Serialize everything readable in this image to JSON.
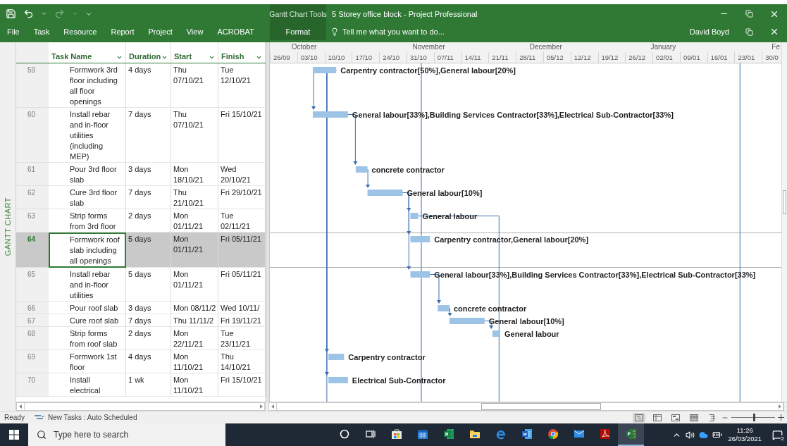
{
  "title_bar": {
    "contextual_group": "Gantt Chart Tools",
    "title": "5 Storey office block - Project Professional"
  },
  "ribbon": {
    "tabs": [
      {
        "label": "File",
        "contextual": false
      },
      {
        "label": "Task",
        "contextual": false
      },
      {
        "label": "Resource",
        "contextual": false
      },
      {
        "label": "Report",
        "contextual": false
      },
      {
        "label": "Project",
        "contextual": false
      },
      {
        "label": "View",
        "contextual": false
      },
      {
        "label": "ACROBAT",
        "contextual": false
      },
      {
        "label": "Format",
        "contextual": true
      }
    ],
    "tell_me": "Tell me what you want to do...",
    "user": "David Boyd"
  },
  "view_bar": {
    "label": "GANTT CHART"
  },
  "table": {
    "columns": [
      {
        "label": "Task Name"
      },
      {
        "label": "Duration"
      },
      {
        "label": "Start"
      },
      {
        "label": "Finish"
      }
    ],
    "rows": [
      {
        "id": "59",
        "name": "Formwork 3rd floor including all floor openings",
        "duration": "4 days",
        "start": "Thu 07/10/21",
        "finish": "Tue 12/10/21",
        "selected": false
      },
      {
        "id": "60",
        "name": "Install rebar and in-floor utilities (including MEP)",
        "duration": "7 days",
        "start": "Thu 07/10/21",
        "finish": "Fri 15/10/21",
        "selected": false
      },
      {
        "id": "61",
        "name": "Pour 3rd floor slab",
        "duration": "3 days",
        "start": "Mon 18/10/21",
        "finish": "Wed 20/10/21",
        "selected": false
      },
      {
        "id": "62",
        "name": "Cure 3rd floor slab",
        "duration": "7 days",
        "start": "Thu 21/10/21",
        "finish": "Fri 29/10/21",
        "selected": false
      },
      {
        "id": "63",
        "name": "Strip forms from 3rd floor",
        "duration": "2 days",
        "start": "Mon 01/11/21",
        "finish": "Tue 02/11/21",
        "selected": false
      },
      {
        "id": "64",
        "name": "Formwork roof slab including all openings",
        "duration": "5 days",
        "start": "Mon 01/11/21",
        "finish": "Fri 05/11/21",
        "selected": true
      },
      {
        "id": "65",
        "name": "Install rebar and in-floor utilities",
        "duration": "5 days",
        "start": "Mon 01/11/21",
        "finish": "Fri 05/11/21",
        "selected": false
      },
      {
        "id": "66",
        "name": "Pour roof slab",
        "duration": "3 days",
        "start": "Mon 08/11/2",
        "finish": "Wed 10/11/",
        "selected": false
      },
      {
        "id": "67",
        "name": "Cure roof slab",
        "duration": "7 days",
        "start": "Thu 11/11/2",
        "finish": "Fri 19/11/21",
        "selected": false
      },
      {
        "id": "68",
        "name": "Strip forms from roof slab",
        "duration": "2 days",
        "start": "Mon 22/11/21",
        "finish": "Tue 23/11/21",
        "selected": false
      },
      {
        "id": "69",
        "name": "Formwork 1st floor",
        "duration": "4 days",
        "start": "Mon 11/10/21",
        "finish": "Thu 14/10/21",
        "selected": false
      },
      {
        "id": "70",
        "name": "Install electrical",
        "duration": "1 wk",
        "start": "Mon 11/10/21",
        "finish": "Fri 15/10/21",
        "selected": false
      }
    ]
  },
  "gantt": {
    "months": [
      "October",
      "November",
      "December",
      "January",
      "Fe"
    ],
    "bar_labels": [
      "Carpentry contractor[50%],General labour[20%]",
      "General labour[33%],Building Services Contractor[33%],Electrical Sub-Contractor[33%]",
      "concrete contractor",
      "General labour[10%]",
      "General labour",
      "Carpentry contractor,General labour[20%]",
      "General labour[33%],Building Services Contractor[33%],Electrical Sub-Contractor[33%]",
      "concrete contractor",
      "General labour[10%]",
      "General labour",
      "Carpentry contractor",
      "Electrical Sub-Contractor"
    ],
    "weeks": [
      "26/09",
      "03/10",
      "10/10",
      "17/10",
      "24/10",
      "31/10",
      "07/11",
      "14/11",
      "21/11",
      "28/11",
      "05/12",
      "12/12",
      "19/12",
      "26/12",
      "02/01",
      "09/01",
      "16/01",
      "23/01",
      "30/0"
    ]
  },
  "status_bar": {
    "ready": "Ready",
    "mode": "New Tasks : Auto Scheduled",
    "zoom": {
      "level": 0.5
    }
  },
  "taskbar": {
    "search_placeholder": "Type here to search",
    "apps": [
      {
        "kind": "cortana",
        "active": false
      },
      {
        "kind": "taskview",
        "active": false
      },
      {
        "kind": "store",
        "active": false
      },
      {
        "kind": "calendar",
        "active": false
      },
      {
        "kind": "spreadsheet",
        "active": false
      },
      {
        "kind": "folder",
        "active": false
      },
      {
        "kind": "browser",
        "active": false
      },
      {
        "kind": "document",
        "active": false
      },
      {
        "kind": "chrome",
        "active": false
      },
      {
        "kind": "mail",
        "active": false
      },
      {
        "kind": "pdf",
        "active": false
      },
      {
        "kind": "project",
        "active": true
      }
    ],
    "time": "11:26",
    "date": "26/03/2021",
    "notifications": "2"
  }
}
